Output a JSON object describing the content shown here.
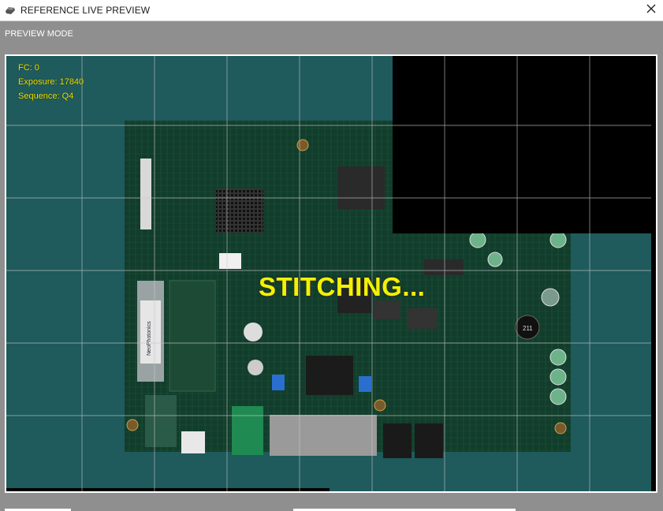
{
  "window": {
    "title": "REFERENCE LIVE PREVIEW",
    "icon": "camera-icon",
    "close_icon": "close-icon"
  },
  "preview": {
    "mode_label": "PREVIEW MODE",
    "overlay": {
      "fc": "FC: 0",
      "exposure": "Exposure: 17840",
      "sequence": "Sequence: Q4"
    },
    "status": "STITCHING...",
    "grid": {
      "columns": 9,
      "rows": 6
    },
    "colors": {
      "background": "#1f5a5c",
      "board": "#123d2c",
      "overlay_text": "#f2e600",
      "grid_line": "#c8c8c8",
      "unscanned": "#000000"
    },
    "board_labels": {
      "vendor": "NeoPhotonics",
      "chip": "211"
    }
  }
}
